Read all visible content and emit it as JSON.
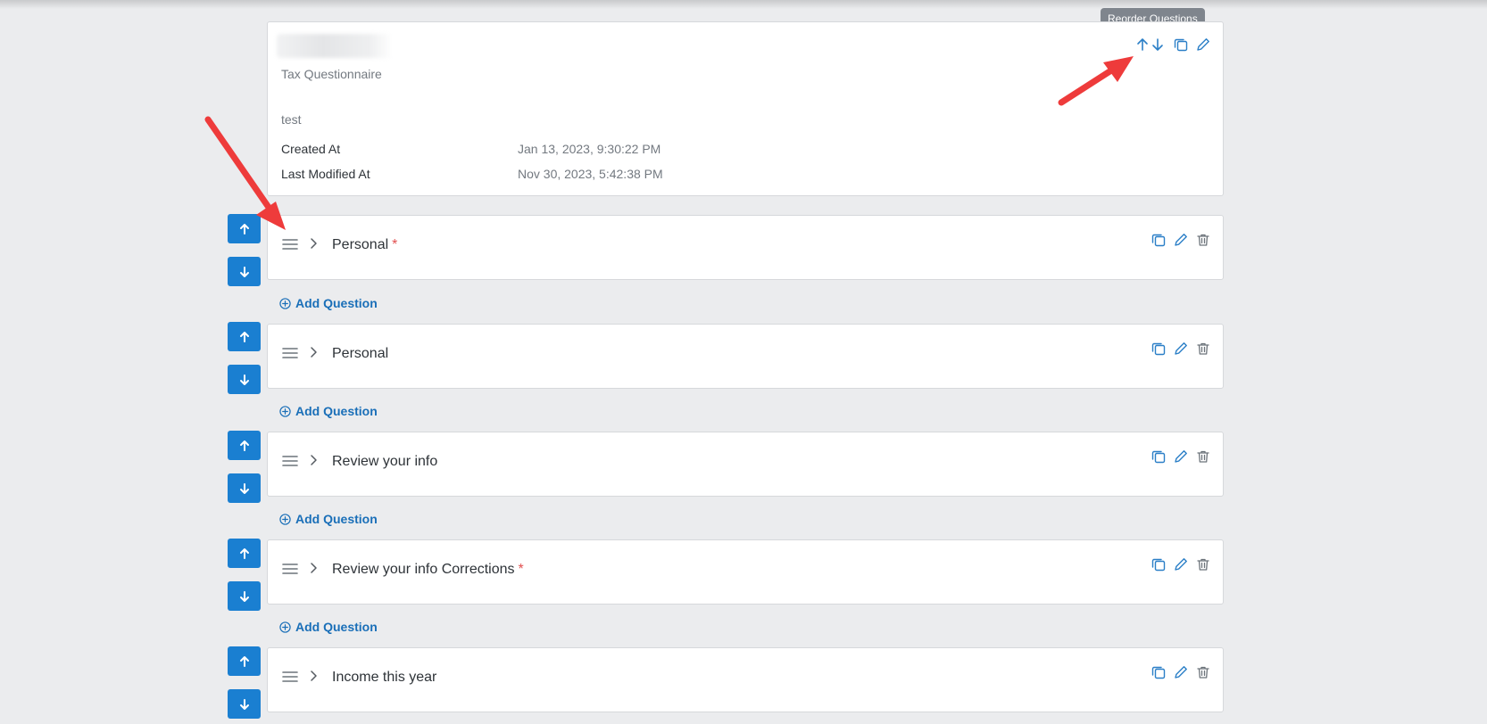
{
  "tooltip": {
    "text": "Reorder Questions"
  },
  "questionnaire": {
    "subtitle": "Tax Questionnaire",
    "description": "test",
    "created_label": "Created At",
    "created_value": "Jan 13, 2023, 9:30:22 PM",
    "modified_label": "Last Modified At",
    "modified_value": "Nov 30, 2023, 5:42:38 PM"
  },
  "add_question_label": "Add Question",
  "required_marker": "*",
  "questions": [
    {
      "title": "Personal",
      "required": true
    },
    {
      "title": "Personal",
      "required": false
    },
    {
      "title": "Review your info",
      "required": false
    },
    {
      "title": "Review your info Corrections",
      "required": true
    },
    {
      "title": "Income this year",
      "required": false
    }
  ],
  "colors": {
    "accent": "#1a7fd1",
    "link": "#1a6fb8",
    "icon": "#2b7fc7",
    "trash": "#6c737a",
    "required": "#e25050",
    "annotation_arrow": "#ee3b3b"
  }
}
